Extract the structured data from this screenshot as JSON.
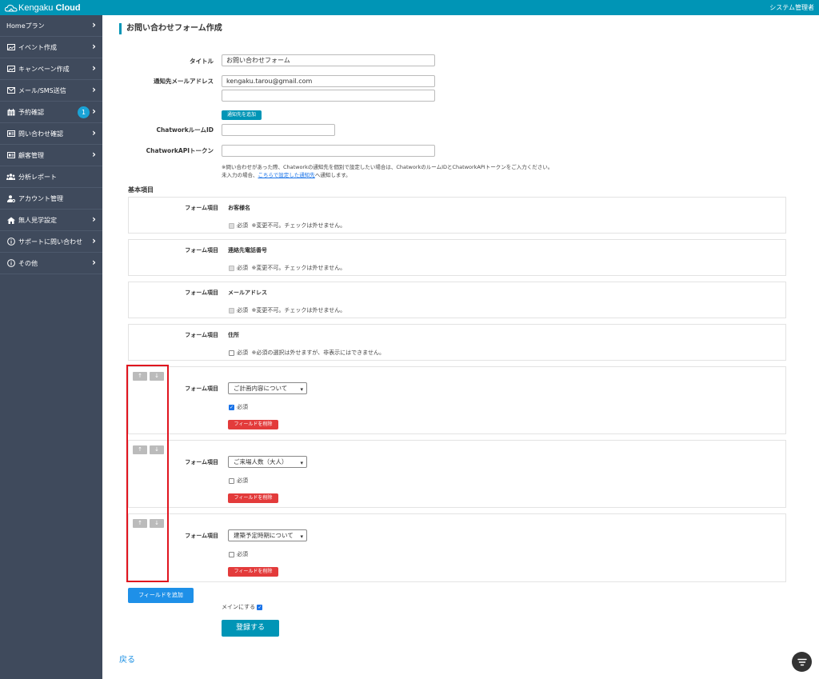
{
  "header": {
    "brand_a": "Kengaku",
    "brand_b": "Cloud",
    "user_label": "システム管理者"
  },
  "sidebar": {
    "items": [
      {
        "label": "Homeプラン",
        "icon": "none",
        "chevron": true
      },
      {
        "label": "イベント作成",
        "icon": "image-icon",
        "chevron": true
      },
      {
        "label": "キャンペーン作成",
        "icon": "image-icon",
        "chevron": true
      },
      {
        "label": "メール/SMS送信",
        "icon": "mail-icon",
        "chevron": true
      },
      {
        "label": "予約確認",
        "icon": "calendar-icon",
        "chevron": true,
        "badge": "1"
      },
      {
        "label": "問い合わせ確認",
        "icon": "id-card-icon",
        "chevron": true
      },
      {
        "label": "顧客管理",
        "icon": "id-card-icon",
        "chevron": true
      },
      {
        "label": "分析レポート",
        "icon": "users-icon",
        "chevron": false
      },
      {
        "label": "アカウント管理",
        "icon": "user-gear-icon",
        "chevron": false
      },
      {
        "label": "無人見学設定",
        "icon": "home-icon",
        "chevron": true
      },
      {
        "label": "サポートに問い合わせ",
        "icon": "info-icon",
        "chevron": true
      },
      {
        "label": "その他",
        "icon": "info-icon",
        "chevron": true
      }
    ]
  },
  "page": {
    "title": "お問い合わせフォーム作成",
    "form": {
      "title_label": "タイトル",
      "title_value": "お問い合わせフォーム",
      "email_label": "通知先メールアドレス",
      "email_value_1": "kengaku.tarou@gmail.com",
      "email_value_2": "",
      "add_email_button": "通知先を追加",
      "chatwork_room_label": "ChatworkルームID",
      "chatwork_room_value": "",
      "chatwork_token_label": "ChatworkAPIトークン",
      "chatwork_token_value": "",
      "note_line1": "※問い合わせがあった際、Chatworkの通知先を個別で設定したい場合は、ChatworkのルームIDとChatworkAPIトークンをご入力ください。",
      "note_line2_a": "未入力の場合、",
      "note_line2_link": "こちらで設定した通知先",
      "note_line2_b": "へ通知します。"
    },
    "basic_section_title": "基本項目",
    "field_label": "フォーム項目",
    "required_label": "必須",
    "fixed_fields": [
      {
        "name": "お客様名",
        "note": "※変更不可。チェックは外せません。"
      },
      {
        "name": "連絡先電話番号",
        "note": "※変更不可。チェックは外せません。"
      },
      {
        "name": "メールアドレス",
        "note": "※変更不可。チェックは外せません。"
      },
      {
        "name": "住所",
        "note": "※必須の選択は外せますが、非表示にはできません。"
      }
    ],
    "custom_fields": [
      {
        "selected": "ご計画内容について",
        "required": true
      },
      {
        "selected": "ご来場人数（大人）",
        "required": false
      },
      {
        "selected": "建築予定時期について",
        "required": false
      }
    ],
    "up_arrow": "↑",
    "down_arrow": "↓",
    "delete_button": "フィールドを削除",
    "add_field_button": "フィールドを追加",
    "main_checkbox_label": "メインにする",
    "submit_button": "登録する",
    "back_link": "戻る"
  },
  "colors": {
    "brand": "#0095b6",
    "sidebar": "#3f4a5c",
    "danger": "#e33b3b",
    "primary": "#1e90e8",
    "highlight": "#e0141e"
  }
}
